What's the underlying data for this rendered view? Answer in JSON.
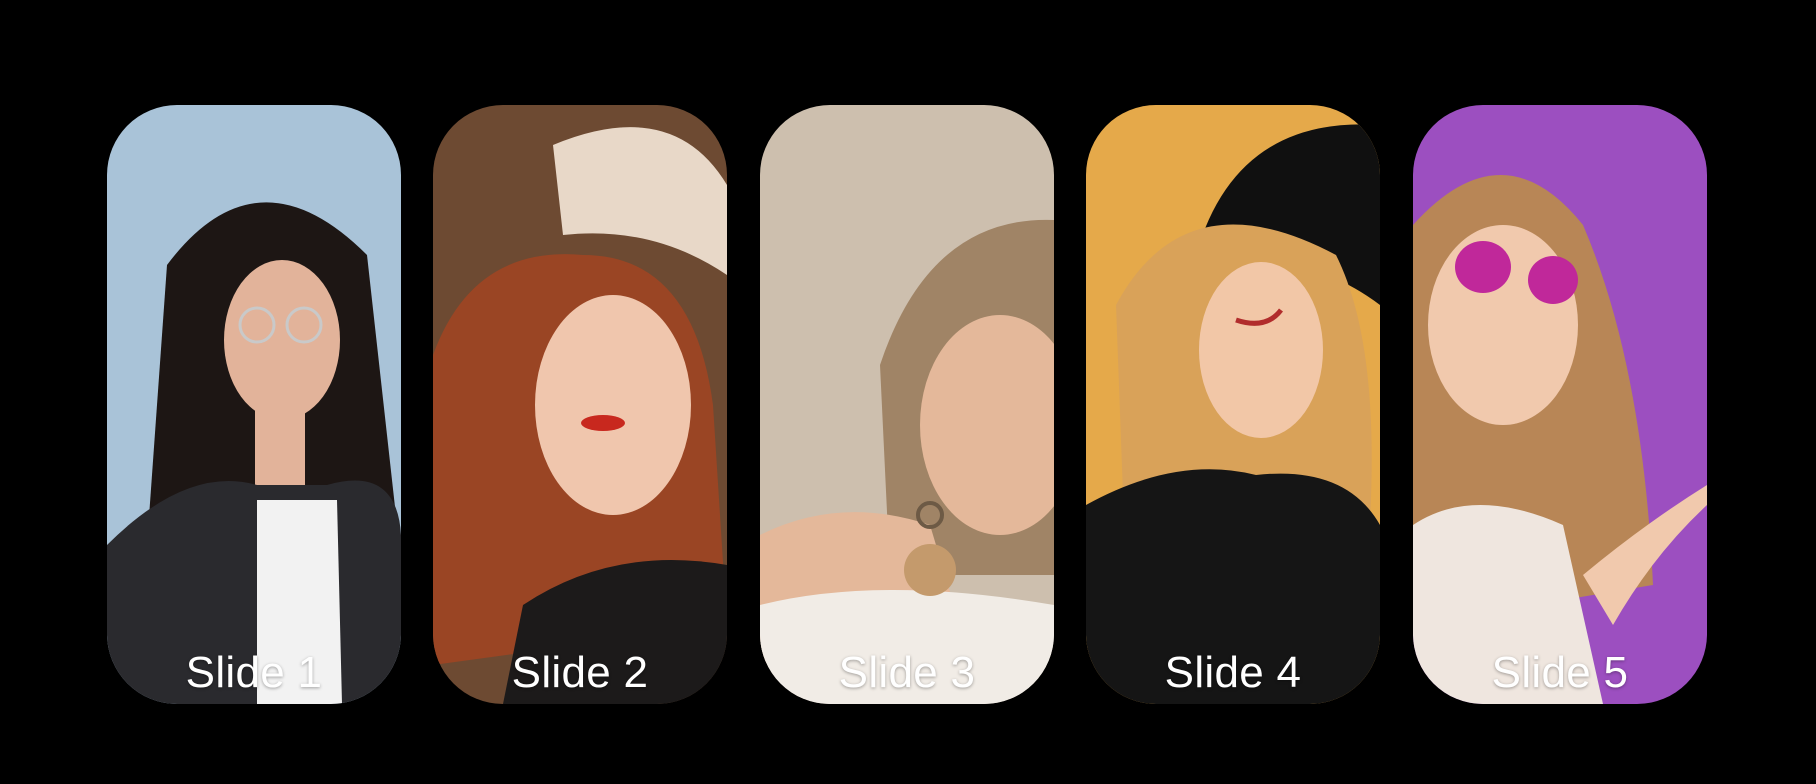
{
  "carousel": {
    "slides": [
      {
        "label": "Slide 1",
        "bg": "#a9c3d8",
        "hair": "#1d1614",
        "skin": "#e2b39a",
        "top": "#2a2a2e",
        "accent": "#f2f2f2"
      },
      {
        "label": "Slide 2",
        "bg": "#6d4a32",
        "hair": "#9a4524",
        "skin": "#f0c6ad",
        "top": "#1c1a1a",
        "accent": "#e8d8c8"
      },
      {
        "label": "Slide 3",
        "bg": "#cdbfae",
        "hair": "#a08466",
        "skin": "#e4b89a",
        "top": "#f1ece6",
        "accent": "#c49a6c"
      },
      {
        "label": "Slide 4",
        "bg": "#e5a94a",
        "hair": "#d9a259",
        "skin": "#f2c7a7",
        "top": "#151515",
        "accent": "#101010"
      },
      {
        "label": "Slide 5",
        "bg": "#9c4fc0",
        "hair": "#b88656",
        "skin": "#f1c9ad",
        "top": "#efe6df",
        "accent": "#c0289a"
      }
    ]
  }
}
